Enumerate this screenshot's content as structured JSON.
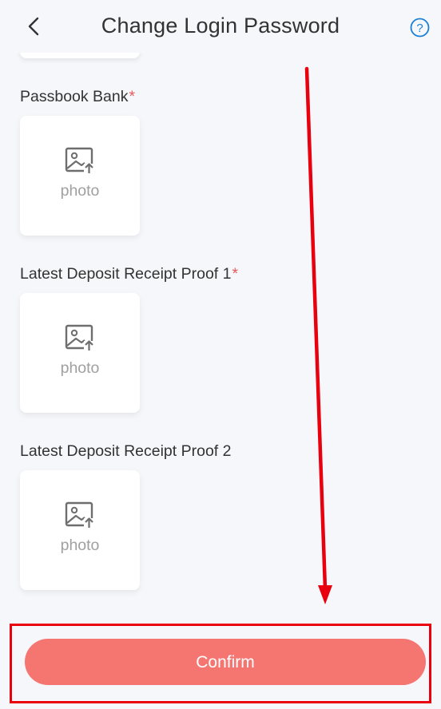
{
  "header": {
    "title": "Change Login Password",
    "back_icon": "chevron-left-icon",
    "help_icon": "question-circle-icon",
    "help_symbol": "?"
  },
  "form": {
    "fields": [
      {
        "label": "Passbook Bank",
        "required_mark": "*",
        "upload_text": "photo"
      },
      {
        "label": "Latest Deposit Receipt Proof 1",
        "required_mark": "*",
        "upload_text": "photo"
      },
      {
        "label": "Latest Deposit Receipt Proof 2",
        "required_mark": "",
        "upload_text": "photo"
      }
    ]
  },
  "footer": {
    "confirm_label": "Confirm"
  },
  "colors": {
    "accent_button": "#f57571",
    "annotation": "#e8000e",
    "help_icon": "#1a7fd6",
    "required_star": "#e85a5a"
  }
}
